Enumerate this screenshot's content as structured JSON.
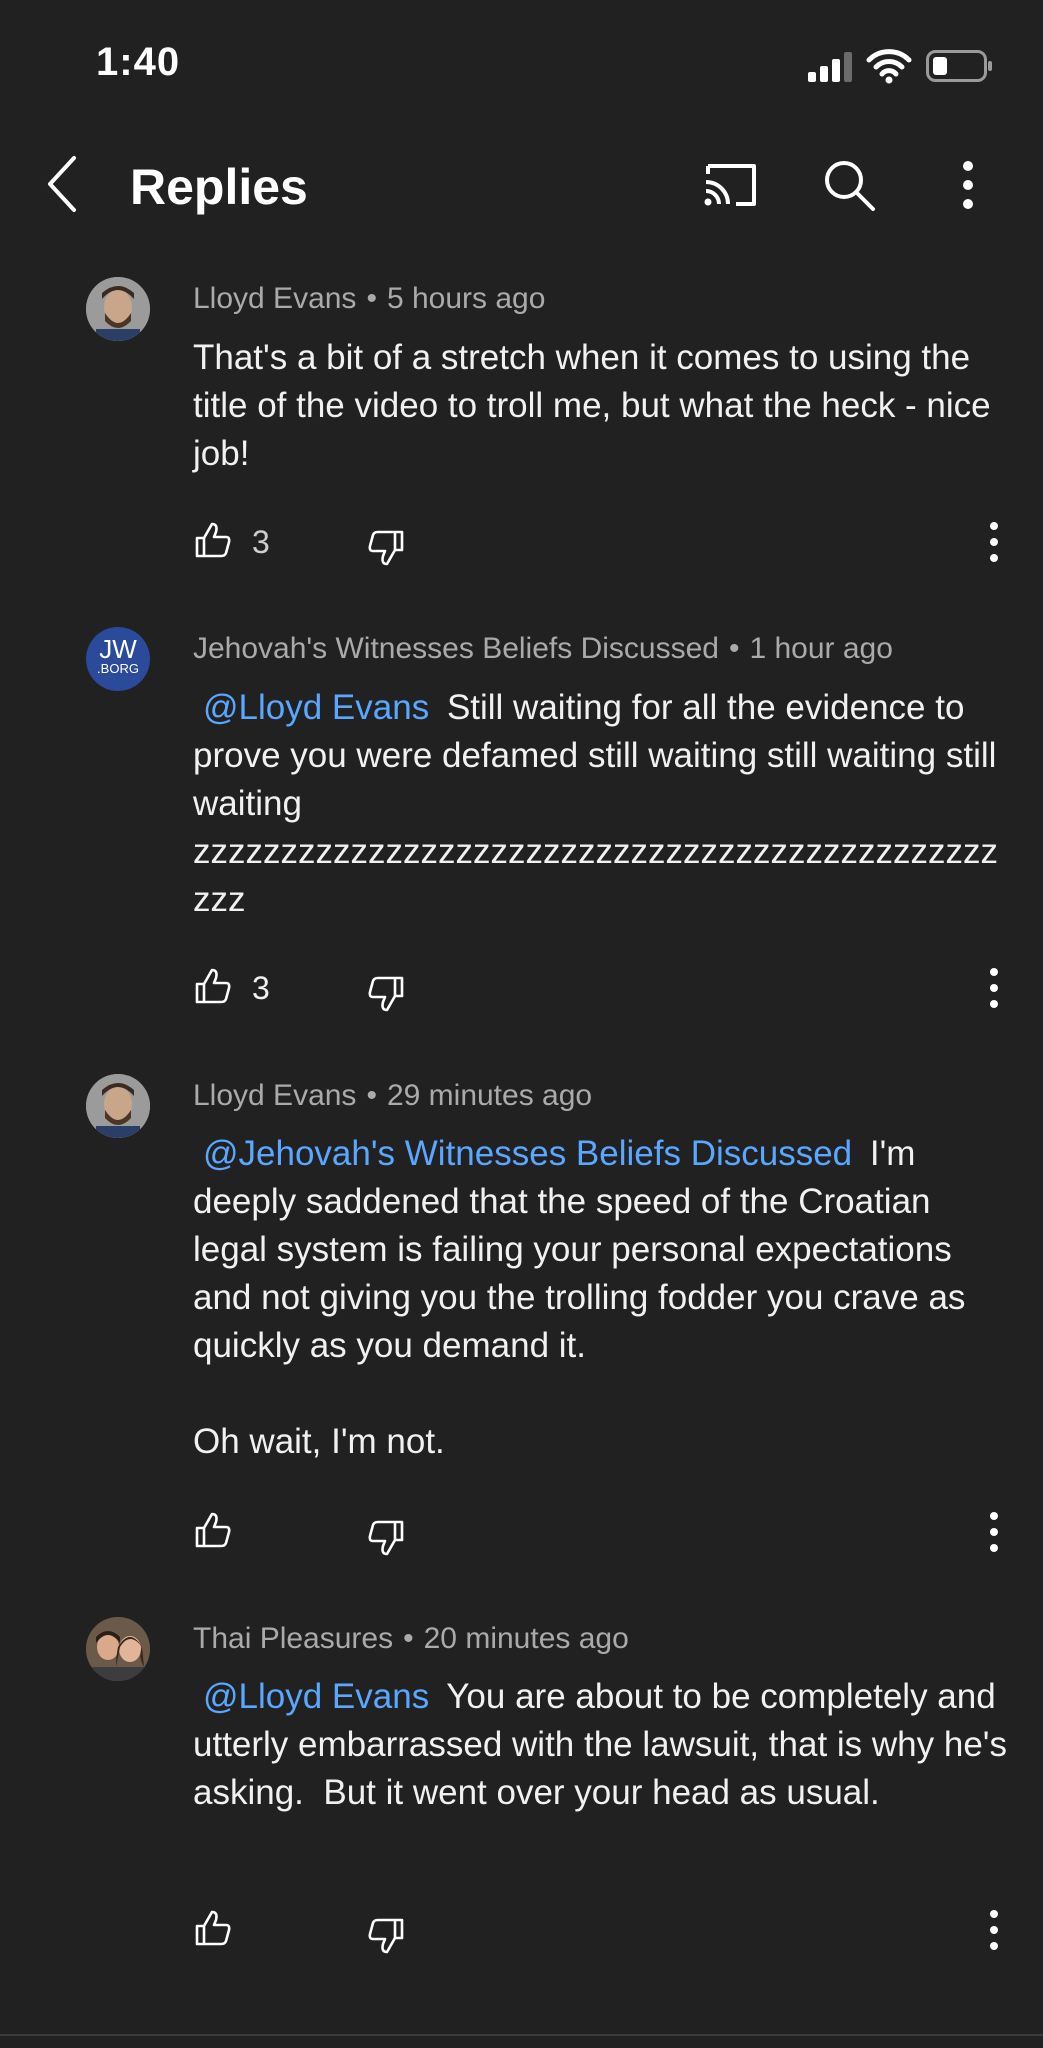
{
  "status": {
    "time": "1:40"
  },
  "header": {
    "title": "Replies"
  },
  "comments": [
    {
      "author": "Lloyd Evans",
      "time": "5 hours ago",
      "mention": "",
      "text": "That's a bit of a stretch when it comes to using the title of the video to troll me, but what the heck - nice job!",
      "likes": "3"
    },
    {
      "author": "Jehovah's Witnesses Beliefs Discussed",
      "time": "1 hour ago",
      "mention": "@Lloyd Evans",
      "text": "Still waiting for all the evidence to prove you were defamed still waiting still waiting still waiting zzzzzzzzzzzzzzzzzzzzzzzzzzzzzzzzzzzzzzzzzzzzzzzzz",
      "likes": "3",
      "avatar_text_1": "JW",
      "avatar_text_2": ".BORG"
    },
    {
      "author": "Lloyd Evans",
      "time": "29 minutes ago",
      "mention": "@Jehovah's Witnesses Beliefs Discussed",
      "text": "I'm deeply saddened that the speed of the Croatian legal system is failing your personal expectations and not giving you the trolling fodder you crave as quickly as you demand it.\n\nOh wait, I'm not.",
      "likes": ""
    },
    {
      "author": "Thai Pleasures",
      "time": "20 minutes ago",
      "mention": "@Lloyd Evans",
      "text": "You are about to be completely and utterly embarrassed with the lawsuit, that is why he's asking.  But it went over your head as usual.",
      "likes": ""
    }
  ],
  "colors": {
    "background": "#212121",
    "mention": "#5aa7ff",
    "meta": "#aaaaaa",
    "jw_blue": "#2b4a9a"
  },
  "icons": [
    "back-icon",
    "cast-icon",
    "search-icon",
    "more-vert-icon",
    "thumb-up-icon",
    "thumb-down-icon",
    "signal-icon",
    "wifi-icon",
    "battery-icon"
  ]
}
